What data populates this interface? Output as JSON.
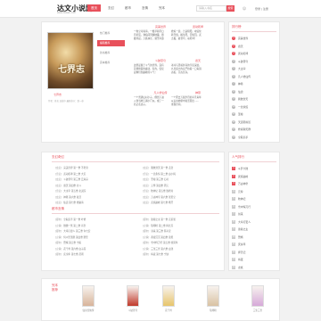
{
  "header": {
    "logo": "达文小说网",
    "logo_sub": "www.dawen.com",
    "nav": [
      "首页",
      "玄幻",
      "都市",
      "言情",
      "完本"
    ],
    "search_placeholder": "请输入书名",
    "search_button": "搜索",
    "links": "登录 | 注册"
  },
  "featured": {
    "cover_title": "七界志",
    "caption": "七界志",
    "desc": "作者：佚名 连载中 最新章节：第一章",
    "tabs": [
      "热门推荐",
      "编辑推荐",
      "新书推荐",
      "完本推荐"
    ],
    "col1_title": "完美世界",
    "col1_lines": [
      "一粒尘可填海，一根草斩尽日",
      "月星辰，弹指间天翻地覆。群",
      "雄并起，万族林立，诸圣争霸"
    ],
    "col2_title": "武动乾坤",
    "col2_lines": [
      "修炼一途，乃窃阴阳，夺造化",
      "转涅槃，握生死，掌轮回。武",
      "之极，破苍穹，动乾坤！"
    ],
    "col3_title": "斗破苍穹",
    "col3_lines": [
      "这里是属于斗气的世界，没有",
      "花俏艳丽的魔法，有的，仅仅",
      "是繁衍到巅峰的斗气！"
    ],
    "col4_title": "遮天",
    "col4_lines": [
      "冰冷与黑暗并存的宇宙深处，",
      "九具庞大的龙尸拉着一口青铜",
      "古棺，亘古长存。"
    ],
    "col5_title": "凡人修仙传",
    "col5_lines": [
      "一个普通山村小子，偶然下进",
      "入到当地江湖小门派，成了一",
      "名记名弟子。"
    ],
    "col6_title": "神墓",
    "col6_lines": [
      "一个死去万载岁月的平凡青年",
      "从远古神墓中复活而出……",
      "重现世间。"
    ]
  },
  "rank1": {
    "title": "排行榜",
    "items": [
      "完美世界",
      "遮天",
      "武动乾坤",
      "斗破苍穹",
      "大主宰",
      "凡人修仙传",
      "神墓",
      "仙逆",
      "我欲封天",
      "一念永恒",
      "圣墟",
      "天道图书馆",
      "修真聊天群",
      "全职高手"
    ]
  },
  "rank2": {
    "title": "人气排行",
    "items": [
      "斗罗大陆",
      "武炼巅峰",
      "万古神帝",
      "元尊",
      "牧神记",
      "雪中悍刀行",
      "剑来",
      "大奉打更人",
      "诡秘之主",
      "赘婿",
      "庆余年",
      "择天记",
      "将夜",
      "龙族"
    ]
  },
  "update1": {
    "title": "玄幻奇幻",
    "left": [
      {
        "cat": "[玄幻]",
        "text": "完美世界 第一章 不老泉"
      },
      {
        "cat": "[奇幻]",
        "text": "武动乾坤 第二章 大荒"
      },
      {
        "cat": "[玄幻]",
        "text": "斗破苍穹 第三章 云岚宗"
      },
      {
        "cat": "[玄幻]",
        "text": "遮天 第四章 北斗"
      },
      {
        "cat": "[奇幻]",
        "text": "大主宰 第五章 北灵院"
      },
      {
        "cat": "[玄幻]",
        "text": "神墓 第六章 复活"
      },
      {
        "cat": "[玄幻]",
        "text": "仙逆 第七章 修魔海"
      }
    ],
    "right": [
      {
        "cat": "[玄幻]",
        "text": "我欲封天 第一章 孟浩"
      },
      {
        "cat": "[奇幻]",
        "text": "一念永恒 第二章 白小纯"
      },
      {
        "cat": "[玄幻]",
        "text": "圣墟 第三章 石村"
      },
      {
        "cat": "[玄幻]",
        "text": "元尊 第四章 周元"
      },
      {
        "cat": "[奇幻]",
        "text": "牧神记 第五章 残老村"
      },
      {
        "cat": "[玄幻]",
        "text": "万古神帝 第六章 张若尘"
      },
      {
        "cat": "[玄幻]",
        "text": "武炼巅峰 第七章 杨开"
      }
    ]
  },
  "update2": {
    "title": "都市言情",
    "left": [
      {
        "cat": "[都市]",
        "text": "全职高手 第一章 叶修"
      },
      {
        "cat": "[言情]",
        "text": "微微一笑 第二章 肖奈"
      },
      {
        "cat": "[都市]",
        "text": "大奉打更人 第三章 许七安"
      },
      {
        "cat": "[言情]",
        "text": "何以笙箫默 第四章 默笙"
      },
      {
        "cat": "[都市]",
        "text": "赘婿 第五章 宁毅"
      },
      {
        "cat": "[言情]",
        "text": "花千骨 第六章 白子画"
      },
      {
        "cat": "[都市]",
        "text": "庆余年 第七章 范闲"
      }
    ],
    "right": [
      {
        "cat": "[都市]",
        "text": "诡秘之主 第一章 克莱恩"
      },
      {
        "cat": "[言情]",
        "text": "琅琊榜 第二章 梅长苏"
      },
      {
        "cat": "[都市]",
        "text": "剑来 第三章 陈平安"
      },
      {
        "cat": "[言情]",
        "text": "香蜜沉沉 第四章 锦觅"
      },
      {
        "cat": "[都市]",
        "text": "雪中悍刀行 第五章 徐凤年"
      },
      {
        "cat": "[言情]",
        "text": "三生三世 第六章 白浅"
      },
      {
        "cat": "[都市]",
        "text": "将夜 第七章 宁缺"
      }
    ]
  },
  "bottom": {
    "label": "完本推荐",
    "books": [
      {
        "title": "仙剑奇侠传",
        "color": "#d8b49a"
      },
      {
        "title": "斗破苍穹",
        "color": "#c0392b"
      },
      {
        "title": "花千骨",
        "color": "#e7c56b"
      },
      {
        "title": "琅琊榜",
        "color": "#d9c2a3"
      },
      {
        "title": "三生三世",
        "color": "#d6a9d9"
      }
    ]
  },
  "colors": {
    "accent": "#e8505b"
  }
}
